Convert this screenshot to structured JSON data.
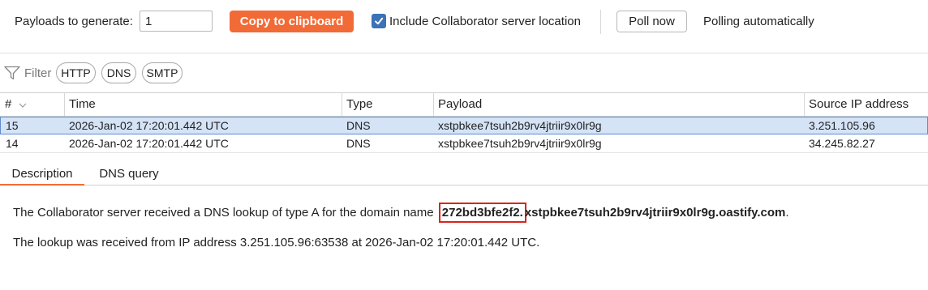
{
  "toolbar": {
    "payloads_label": "Payloads to generate:",
    "payloads_value": "1",
    "copy_button": "Copy to clipboard",
    "include_location_label": "Include Collaborator server location",
    "include_location_checked": true,
    "poll_button": "Poll now",
    "polling_status": "Polling automatically"
  },
  "filter": {
    "label": "Filter",
    "chips": [
      "HTTP",
      "DNS",
      "SMTP"
    ]
  },
  "table": {
    "columns": [
      "#",
      "Time",
      "Type",
      "Payload",
      "Source IP address"
    ],
    "rows": [
      {
        "num": "15",
        "time": "2026-Jan-02 17:20:01.442 UTC",
        "type": "DNS",
        "payload": "xstpbkee7tsuh2b9rv4jtriir9x0lr9g",
        "source_ip": "3.251.105.96",
        "selected": true
      },
      {
        "num": "14",
        "time": "2026-Jan-02 17:20:01.442 UTC",
        "type": "DNS",
        "payload": "xstpbkee7tsuh2b9rv4jtriir9x0lr9g",
        "source_ip": "34.245.82.27",
        "selected": false
      }
    ]
  },
  "detail_tabs": [
    "Description",
    "DNS query"
  ],
  "active_detail_tab": "Description",
  "description": {
    "line1_prefix": "The Collaborator server received a DNS lookup of type A for the domain name ",
    "line1_highlight": "272bd3bfe2f2.",
    "line1_domain": "xstpbkee7tsuh2b9rv4jtriir9x0lr9g.oastify.com",
    "line1_suffix": ".",
    "line2": "The lookup was received from IP address 3.251.105.96:63538 at 2026-Jan-02 17:20:01.442 UTC."
  },
  "colors": {
    "accent": "#f26a35",
    "selection": "#d4e3f6",
    "checkbox": "#3c72b8",
    "highlight_box": "#d9251c"
  }
}
